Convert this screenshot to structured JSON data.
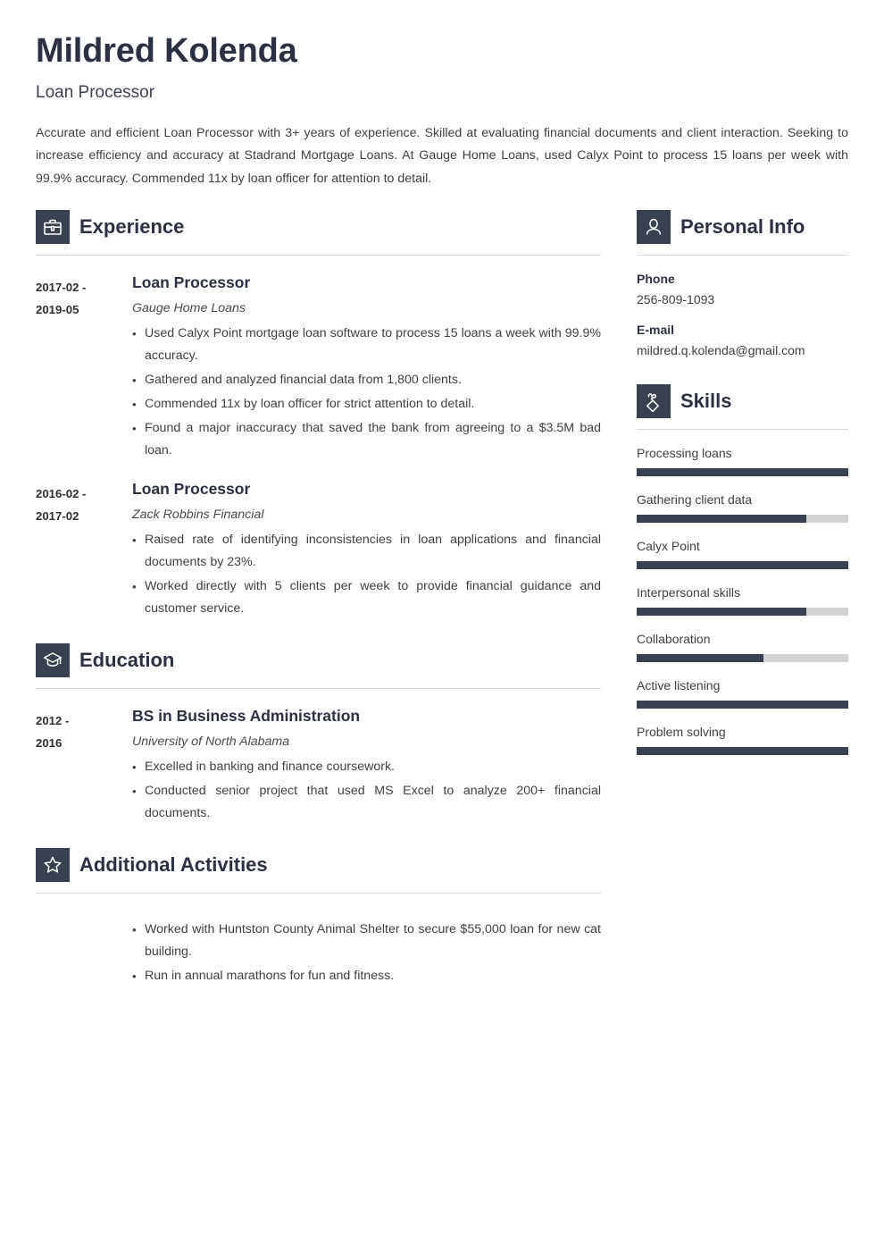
{
  "header": {
    "name": "Mildred Kolenda",
    "job_title": "Loan Processor",
    "summary": "Accurate and efficient Loan Processor with 3+ years of experience. Skilled at evaluating financial documents and client interaction. Seeking to increase efficiency and accuracy at Stadrand Mortgage Loans. At Gauge Home Loans, used Calyx Point to process 15 loans per week with 99.9% accuracy. Commended 11x by loan officer for attention to detail."
  },
  "sections": {
    "experience": {
      "title": "Experience",
      "icon": "briefcase-icon",
      "entries": [
        {
          "dates": "2017-02 - 2019-05",
          "date_line_1": "2017-02 -",
          "date_line_2": "2019-05",
          "role": "Loan Processor",
          "org": "Gauge Home Loans",
          "bullets": [
            "Used Calyx Point mortgage loan software to process 15 loans a week with 99.9% accuracy.",
            "Gathered and analyzed financial data from 1,800 clients.",
            "Commended 11x by loan officer for strict attention to detail.",
            "Found a major inaccuracy that saved the bank from agreeing to a $3.5M bad loan."
          ]
        },
        {
          "dates": "2016-02 - 2017-02",
          "date_line_1": "2016-02 -",
          "date_line_2": "2017-02",
          "role": "Loan Processor",
          "org": "Zack Robbins Financial",
          "bullets": [
            "Raised rate of identifying inconsistencies in loan applications and financial documents by 23%.",
            "Worked directly with 5 clients per week to provide financial guidance and customer service."
          ]
        }
      ]
    },
    "education": {
      "title": "Education",
      "icon": "graduation-cap-icon",
      "entries": [
        {
          "dates": "2012 - 2016",
          "date_line_1": "2012 -",
          "date_line_2": "2016",
          "role": "BS in Business Administration",
          "org": "University of North Alabama",
          "bullets": [
            "Excelled in banking and finance coursework.",
            "Conducted senior project that used MS Excel to analyze 200+ financial documents."
          ]
        }
      ]
    },
    "activities": {
      "title": "Additional Activities",
      "icon": "star-icon",
      "bullets": [
        "Worked with Huntston County Animal Shelter to secure $55,000 loan for new cat building.",
        "Run in annual marathons for fun and fitness."
      ]
    },
    "personal_info": {
      "title": "Personal Info",
      "icon": "person-icon",
      "fields": [
        {
          "label": "Phone",
          "value": "256-809-1093"
        },
        {
          "label": "E-mail",
          "value": "mildred.q.kolenda@gmail.com"
        }
      ]
    },
    "skills": {
      "title": "Skills",
      "icon": "puzzle-piece-icon",
      "items": [
        {
          "name": "Processing loans",
          "level": 100
        },
        {
          "name": "Gathering client data",
          "level": 80
        },
        {
          "name": "Calyx Point",
          "level": 100
        },
        {
          "name": "Interpersonal skills",
          "level": 80
        },
        {
          "name": "Collaboration",
          "level": 60
        },
        {
          "name": "Active listening",
          "level": 100
        },
        {
          "name": "Problem solving",
          "level": 100
        }
      ]
    }
  },
  "colors": {
    "accent_dark": "#39404f",
    "heading": "#2b3140",
    "body_text": "#3f3f3f",
    "rule": "#d8d8d8",
    "skill_track": "#d4d4d4"
  }
}
